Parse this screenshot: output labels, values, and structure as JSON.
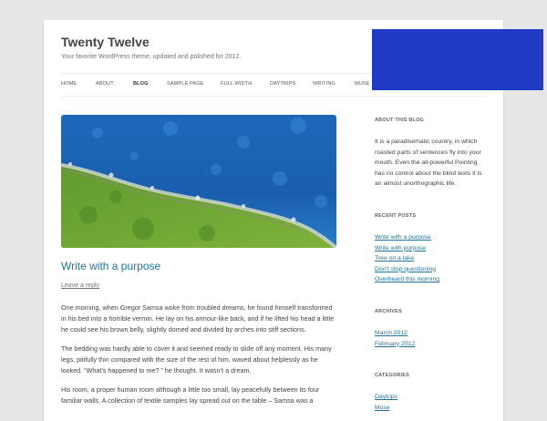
{
  "site": {
    "title": "Twenty Twelve",
    "description": "Your favorite WordPress theme, updated and polished for 2012."
  },
  "nav": [
    "HOME",
    "ABOUT",
    "BLOG",
    "SAMPLE PAGE",
    "FULL WIDTH",
    "DAYTRIPS",
    "WRITING",
    "MUSE"
  ],
  "nav_current": "BLOG",
  "overlay_color": "#1f3bc6",
  "post": {
    "title": "Write with a purpose",
    "reply": "Leave a reply",
    "paragraphs": [
      [
        "One morning, when Gregor Samsa woke from troubled dreams, he found himself transformed",
        "in his bed into a horrible vermin. He lay on his armour-like back, and if he lifted his head a little",
        "he could see his brown belly, slightly domed and divided by arches into stiff sections."
      ],
      [
        "The bedding was hardly able to cover it and seemed ready to slide off any moment. His many",
        "legs, pitifully thin compared with the size of the rest of him, waved about helplessly as he",
        "looked. “What’s happened to me? ” he thought. It wasn’t a dream."
      ],
      [
        "His room, a proper human room although a little too small, lay peacefully between its four",
        "familiar walls. A collection of textile samples lay spread out on the table – Samsa was a"
      ]
    ]
  },
  "sidebar": {
    "about": {
      "heading": "ABOUT THIS BLOG",
      "lines": [
        "It is a paradisematic country, in which",
        "roasted parts of sentences fly into your",
        "mouth. Even the all-powerful Pointing",
        "has no control about the blind texts it is",
        "an almost unorthographic life."
      ]
    },
    "recent": {
      "heading": "RECENT POSTS",
      "items": [
        "Write with a purpose",
        "Write with purpose",
        "Tree on a lake",
        "Don't stop questioning",
        "Overheard this morning"
      ]
    },
    "archives": {
      "heading": "ARCHIVES",
      "items": [
        "March 2012",
        "February 2012"
      ]
    },
    "categories": {
      "heading": "CATEGORIES",
      "items": [
        "Daytrips",
        "Muse"
      ]
    }
  }
}
